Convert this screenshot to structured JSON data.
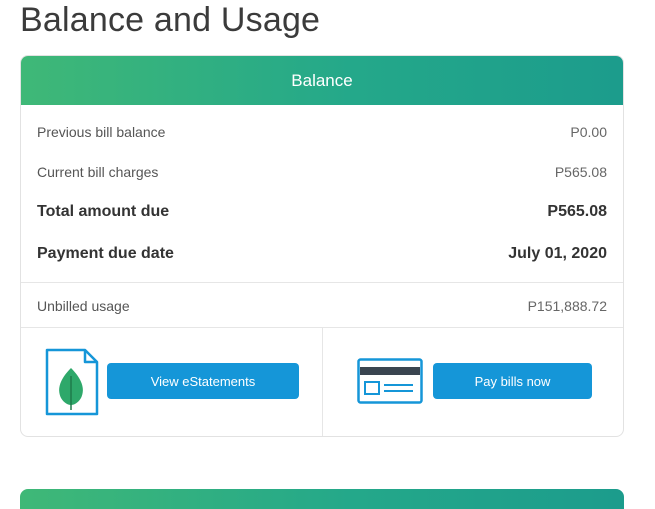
{
  "page": {
    "title": "Balance and Usage"
  },
  "balance_card": {
    "header": "Balance",
    "rows": [
      {
        "label": "Previous bill balance",
        "value": "P0.00"
      },
      {
        "label": "Current bill charges",
        "value": "P565.08"
      },
      {
        "label": "Total amount due",
        "value": "P565.08"
      },
      {
        "label": "Payment due date",
        "value": "July 01, 2020"
      },
      {
        "label": "Unbilled usage",
        "value": "P151,888.72"
      }
    ],
    "actions": {
      "view_estatements": "View eStatements",
      "pay_bills": "Pay bills now"
    }
  },
  "colors": {
    "header_gradient_start": "#3fb877",
    "header_gradient_end": "#1c9c8c",
    "button": "#1596d8",
    "icon_stroke": "#1596d8",
    "leaf": "#2ea86a"
  },
  "icons": [
    "document-leaf-icon",
    "credit-card-icon"
  ]
}
